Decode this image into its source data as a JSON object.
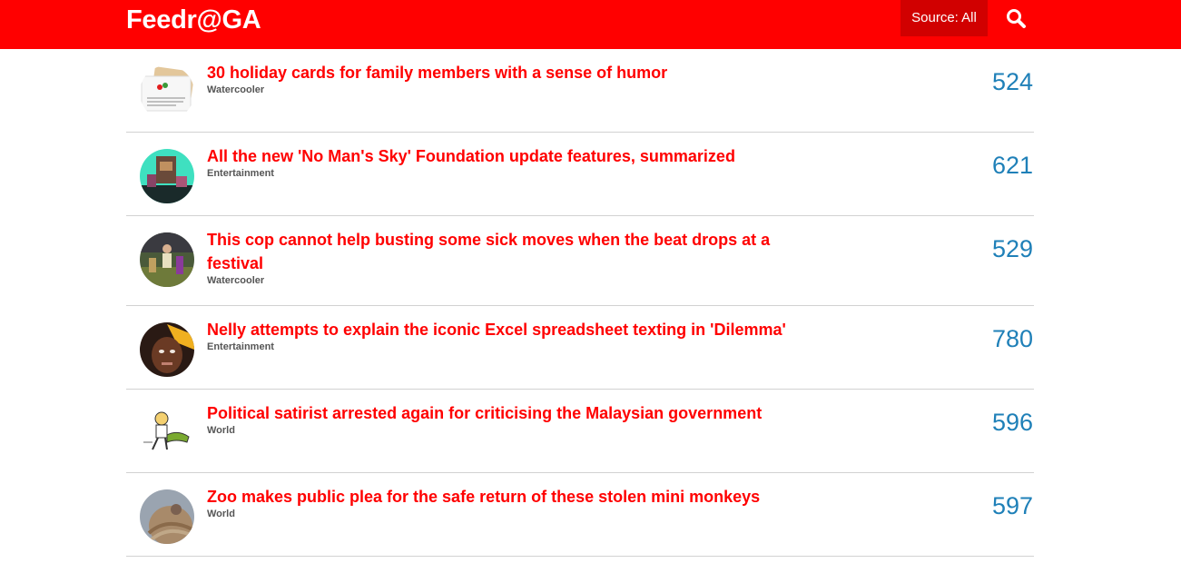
{
  "header": {
    "brand": "Feedr@GA",
    "source_label": "Source: All",
    "search_icon": "search-icon"
  },
  "colors": {
    "brand_red": "#ff0000",
    "source_bg": "#d10000",
    "count_blue": "#1f80b8",
    "category_gray": "#555555"
  },
  "articles": [
    {
      "title": "30 holiday cards for family members with a sense of humor",
      "category": "Watercooler",
      "count": "524",
      "thumb": "holiday-card-thumbnail"
    },
    {
      "title": "All the new 'No Man's Sky' Foundation update features, summarized",
      "category": "Entertainment",
      "count": "621",
      "thumb": "game-screenshot-thumbnail"
    },
    {
      "title": "This cop cannot help busting some sick moves when the beat drops at a festival",
      "category": "Watercooler",
      "count": "529",
      "thumb": "festival-photo-thumbnail"
    },
    {
      "title": "Nelly attempts to explain the iconic Excel spreadsheet texting in 'Dilemma'",
      "category": "Entertainment",
      "count": "780",
      "thumb": "person-photo-thumbnail"
    },
    {
      "title": "Political satirist arrested again for criticising the Malaysian government",
      "category": "World",
      "count": "596",
      "thumb": "cartoon-thumbnail"
    },
    {
      "title": "Zoo makes public plea for the safe return of these stolen mini monkeys",
      "category": "World",
      "count": "597",
      "thumb": "monkey-photo-thumbnail"
    }
  ]
}
